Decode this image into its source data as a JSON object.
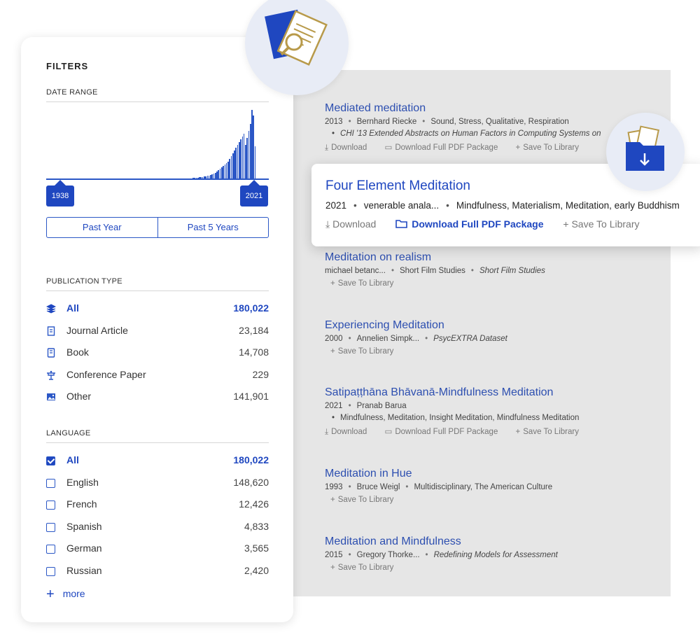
{
  "filters": {
    "title": "FILTERS",
    "date_range": {
      "label": "DATE RANGE",
      "start_year": "1938",
      "end_year": "2021",
      "quick": [
        "Past Year",
        "Past 5 Years"
      ],
      "histogram_levels": [
        0.02,
        0.02,
        0.02,
        0.02,
        0.02,
        0.02,
        0.02,
        0.02,
        0.02,
        0.02,
        0.02,
        0.02,
        0.02,
        0.02,
        0.02,
        0.02,
        0.02,
        0.02,
        0.02,
        0.02,
        0.02,
        0.02,
        0.02,
        0.02,
        0.02,
        0.02,
        0.03,
        0.03,
        0.03,
        0.03,
        0.04,
        0.04,
        0.04,
        0.05,
        0.05,
        0.06,
        0.06,
        0.07,
        0.08,
        0.09,
        0.1,
        0.12,
        0.14,
        0.16,
        0.18,
        0.2,
        0.22,
        0.24,
        0.26,
        0.3,
        0.34,
        0.38,
        0.42,
        0.46,
        0.5,
        0.54,
        0.58,
        0.62,
        0.66,
        0.5,
        0.6,
        0.7,
        0.8,
        1.0,
        0.92,
        0.48
      ]
    },
    "publication_type": {
      "label": "PUBLICATION TYPE",
      "items": [
        {
          "icon": "stack-icon",
          "label": "All",
          "count": "180,022",
          "active": true
        },
        {
          "icon": "journal-icon",
          "label": "Journal Article",
          "count": "23,184"
        },
        {
          "icon": "book-icon",
          "label": "Book",
          "count": "14,708"
        },
        {
          "icon": "conference-icon",
          "label": "Conference Paper",
          "count": "229"
        },
        {
          "icon": "image-icon",
          "label": "Other",
          "count": "141,901"
        }
      ]
    },
    "language": {
      "label": "LANGUAGE",
      "items": [
        {
          "label": "All",
          "count": "180,022",
          "checked": true
        },
        {
          "label": "English",
          "count": "148,620"
        },
        {
          "label": "French",
          "count": "12,426"
        },
        {
          "label": "Spanish",
          "count": "4,833"
        },
        {
          "label": "German",
          "count": "3,565"
        },
        {
          "label": "Russian",
          "count": "2,420"
        }
      ],
      "more_label": "more"
    }
  },
  "results": [
    {
      "title": "Mediated meditation",
      "year": "2013",
      "author": "Bernhard Riecke",
      "tags": "Sound, Stress, Qualitative, Respiration",
      "venue": "CHI '13 Extended Abstracts on Human Factors in Computing Systems on",
      "actions": [
        "Download",
        "Download Full PDF Package",
        "Save To Library"
      ]
    },
    {
      "title": "Meditation on realism",
      "year": "",
      "author": "michael betanc...",
      "tags": "Short Film Studies",
      "venue_inline": "Short Film Studies",
      "actions": [
        "Save To Library"
      ]
    },
    {
      "title": "Experiencing Meditation",
      "year": "2000",
      "author": "Annelien Simpk...",
      "venue_inline": "PsycEXTRA Dataset",
      "actions": [
        "Save To Library"
      ]
    },
    {
      "title": "Satipaṭṭhāna Bhāvanā-Mindfulness Meditation",
      "year": "2021",
      "author": "Pranab Barua",
      "venue": "Mindfulness, Meditation, Insight Meditation, Mindfulness Meditation",
      "actions": [
        "Download",
        "Download Full PDF Package",
        "Save To Library"
      ]
    },
    {
      "title": "Meditation in Hue",
      "year": "1993",
      "author": "Bruce Weigl",
      "tags": "Multidisciplinary, The American Culture",
      "actions": [
        "Save To Library"
      ]
    },
    {
      "title": "Meditation and Mindfulness",
      "year": "2015",
      "author": "Gregory Thorke...",
      "venue_inline": "Redefining Models for Assessment",
      "actions": [
        "Save To Library"
      ]
    }
  ],
  "featured": {
    "title": "Four Element Meditation",
    "year": "2021",
    "author": "venerable anala...",
    "tags": "Mindfulness, Materialism, Meditation, early Buddhism",
    "actions": {
      "download": "Download",
      "package": "Download Full PDF Package",
      "save": "Save To Library"
    }
  },
  "colors": {
    "accent": "#1f47c0",
    "link": "#2d4fb0",
    "panel_bg": "#e6e6e6"
  }
}
